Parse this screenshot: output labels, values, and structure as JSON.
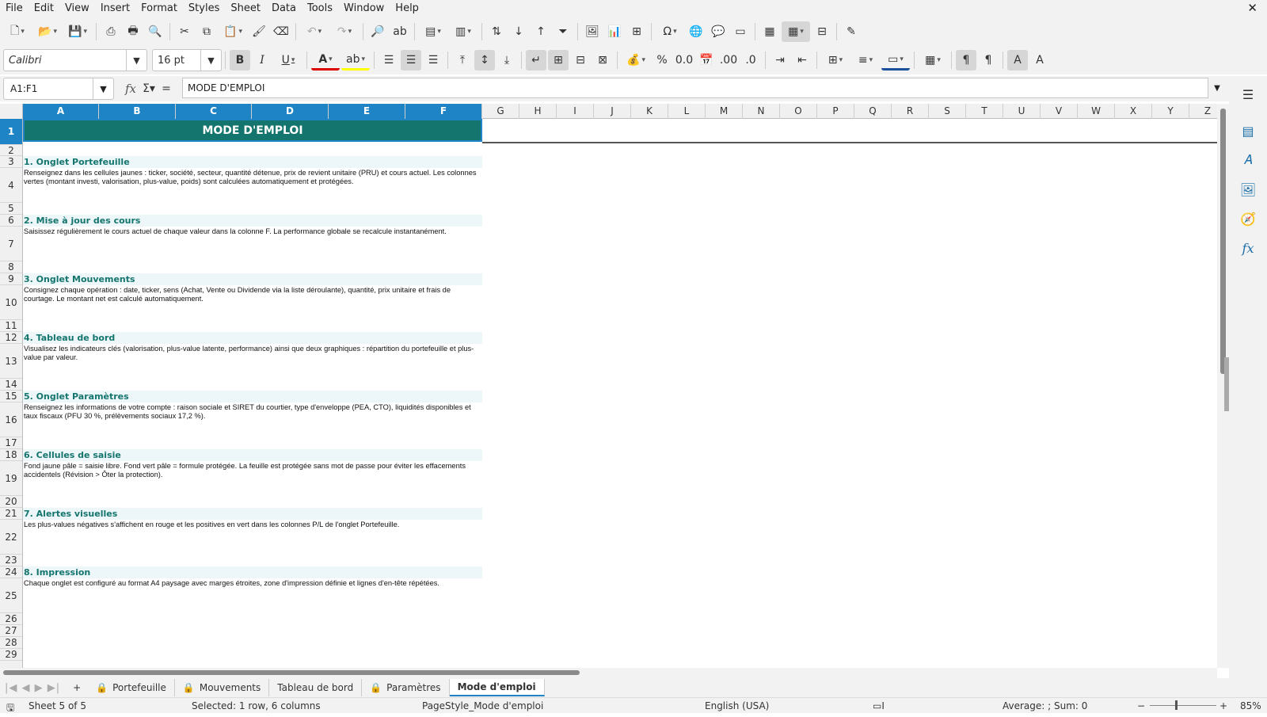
{
  "menu": [
    "File",
    "Edit",
    "View",
    "Insert",
    "Format",
    "Styles",
    "Sheet",
    "Data",
    "Tools",
    "Window",
    "Help"
  ],
  "toolbar": {
    "font_name": "Calibri",
    "font_size": "16 pt"
  },
  "formula_bar": {
    "name_box": "A1:F1",
    "content": "MODE D'EMPLOI"
  },
  "columns": [
    "A",
    "B",
    "C",
    "D",
    "E",
    "F",
    "G",
    "H",
    "I",
    "J",
    "K",
    "L",
    "M",
    "N",
    "O",
    "P",
    "Q",
    "R",
    "S",
    "T",
    "U",
    "V",
    "W",
    "X",
    "Y",
    "Z"
  ],
  "rows": [
    "1",
    "2",
    "3",
    "4",
    "5",
    "6",
    "7",
    "8",
    "9",
    "10",
    "11",
    "12",
    "13",
    "14",
    "15",
    "16",
    "17",
    "18",
    "19",
    "20",
    "21",
    "22",
    "23",
    "24",
    "25",
    "26",
    "27",
    "28",
    "29"
  ],
  "sheet": {
    "title": "MODE D'EMPLOI",
    "sections": [
      {
        "heading": "1. Onglet Portefeuille",
        "text": "Renseignez dans les cellules jaunes : ticker, société, secteur, quantité détenue, prix de revient unitaire (PRU) et cours actuel. Les colonnes vertes (montant investi, valorisation, plus-value, poids) sont calculées automatiquement et protégées."
      },
      {
        "heading": "2. Mise à jour des cours",
        "text": "Saisissez régulièrement le cours actuel de chaque valeur dans la colonne F. La performance globale se recalcule instantanément."
      },
      {
        "heading": "3. Onglet Mouvements",
        "text": "Consignez chaque opération : date, ticker, sens (Achat, Vente ou Dividende via la liste déroulante), quantité, prix unitaire et frais de courtage. Le montant net est calculé automatiquement."
      },
      {
        "heading": "4. Tableau de bord",
        "text": "Visualisez les indicateurs clés (valorisation, plus-value latente, performance) ainsi que deux graphiques : répartition du portefeuille et plus-value par valeur."
      },
      {
        "heading": "5. Onglet Paramètres",
        "text": "Renseignez les informations de votre compte : raison sociale et SIRET du courtier, type d'enveloppe (PEA, CTO), liquidités disponibles et taux fiscaux (PFU 30 %, prélèvements sociaux 17,2 %)."
      },
      {
        "heading": "6. Cellules de saisie",
        "text": "Fond jaune pâle = saisie libre. Fond vert pâle = formule protégée. La feuille est protégée sans mot de passe pour éviter les effacements accidentels (Révision > Ôter la protection)."
      },
      {
        "heading": "7. Alertes visuelles",
        "text": "Les plus-values négatives s'affichent en rouge et les positives en vert dans les colonnes P/L de l'onglet Portefeuille."
      },
      {
        "heading": "8. Impression",
        "text": "Chaque onglet est configuré au format A4 paysage avec marges étroites, zone d'impression définie et lignes d'en-tête répétées."
      }
    ]
  },
  "tabs": [
    {
      "label": "Portefeuille",
      "locked": true
    },
    {
      "label": "Mouvements",
      "locked": true
    },
    {
      "label": "Tableau de bord",
      "locked": false
    },
    {
      "label": "Paramètres",
      "locked": true
    },
    {
      "label": "Mode d'emploi",
      "locked": false,
      "active": true
    }
  ],
  "status": {
    "sheet": "Sheet 5 of 5",
    "selection": "Selected: 1 row, 6 columns",
    "page_style": "PageStyle_Mode d'emploi",
    "language": "English (USA)",
    "summary": "Average: ; Sum: 0",
    "zoom": "85%"
  },
  "colors": {
    "title_bg": "#14756e",
    "heading_text": "#14756e",
    "selection": "#1f84c6"
  }
}
